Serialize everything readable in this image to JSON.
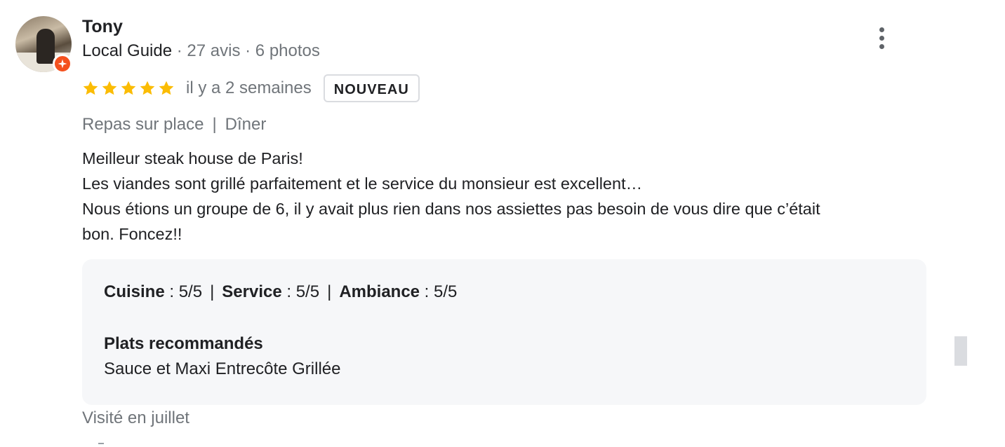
{
  "reviewer": {
    "name": "Tony",
    "level": "Local Guide",
    "separator": " · ",
    "reviews_count": "27 avis",
    "photos_count": "6 photos"
  },
  "review": {
    "stars": 5,
    "max_stars": 5,
    "star_color": "#fbbc04",
    "time_ago": "il y a 2 semaines",
    "new_badge": "NOUVEAU",
    "tags": {
      "service_type": "Repas sur place",
      "separator": "|",
      "meal_type": "Dîner"
    },
    "text_lines": [
      "Meilleur steak house de Paris!",
      "Les viandes sont grillé parfaitement et le service du monsieur est excellent…",
      "Nous étions un groupe de 6, il y avait plus rien dans nos assiettes pas besoin de vous dire que c’était",
      "bon. Foncez!!"
    ],
    "details": {
      "scores": [
        {
          "label": "Cuisine",
          "value": " : 5/5"
        },
        {
          "label": "Service",
          "value": " : 5/5"
        },
        {
          "label": "Ambiance",
          "value": " : 5/5"
        }
      ],
      "score_separator": "|",
      "recommended_title": "Plats recommandés",
      "recommended_value": "Sauce et Maxi Entrecôte Grillée"
    },
    "visited": "Visité en juillet"
  },
  "icons": {
    "menu": "more-vert-icon",
    "guide_badge": "local-guide-star-icon",
    "star": "star-icon"
  },
  "colors": {
    "badge_orange": "#f4511e",
    "secondary_text": "#70757a",
    "details_bg": "#f6f7f9"
  }
}
